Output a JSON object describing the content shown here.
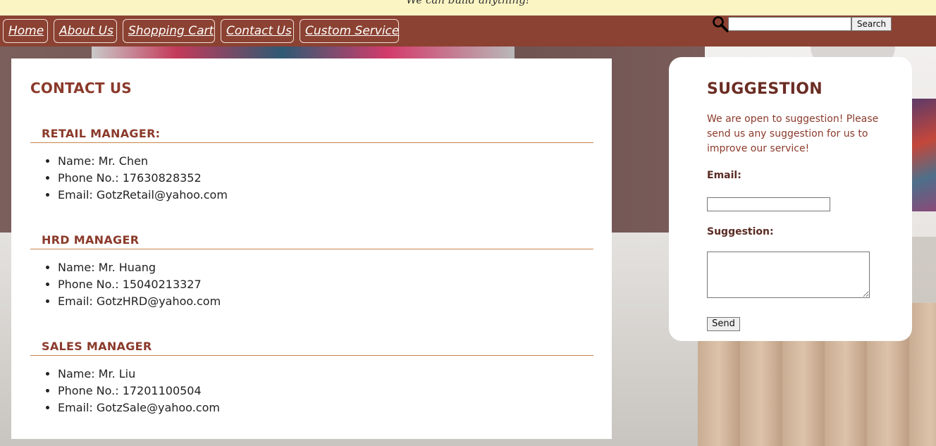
{
  "banner": {
    "tagline": "We can build anything!"
  },
  "nav": {
    "items": [
      {
        "label": "Home"
      },
      {
        "label": "About Us"
      },
      {
        "label": "Shopping Cart"
      },
      {
        "label": "Contact Us"
      },
      {
        "label": "Custom Service"
      }
    ],
    "search_value": "",
    "search_button": "Search",
    "search_icon": "magnifier-icon"
  },
  "contact": {
    "title": "CONTACT US",
    "sections": [
      {
        "heading": "RETAIL MANAGER:",
        "name": "Name: Mr. Chen",
        "phone": "Phone No.: 17630828352",
        "email": "Email: GotzRetail@yahoo.com"
      },
      {
        "heading": "HRD MANAGER",
        "name": "Name: Mr. Huang",
        "phone": "Phone No.: 15040213327",
        "email": "Email: GotzHRD@yahoo.com"
      },
      {
        "heading": "SALES MANAGER",
        "name": "Name: Mr. Liu",
        "phone": "Phone No.: 17201100504",
        "email": "Email: GotzSale@yahoo.com"
      }
    ]
  },
  "suggestion": {
    "title": "SUGGESTION",
    "text": "We are open to suggestion! Please send us any suggestion for us to improve our service!",
    "email_label": "Email:",
    "email_value": "",
    "suggestion_label": "Suggestion:",
    "suggestion_value": "",
    "send_button": "Send"
  },
  "colors": {
    "nav_bg": "#8b4232",
    "banner_bg": "#fbf5c4",
    "heading": "#8b3a2b",
    "divider": "#c8844a"
  }
}
